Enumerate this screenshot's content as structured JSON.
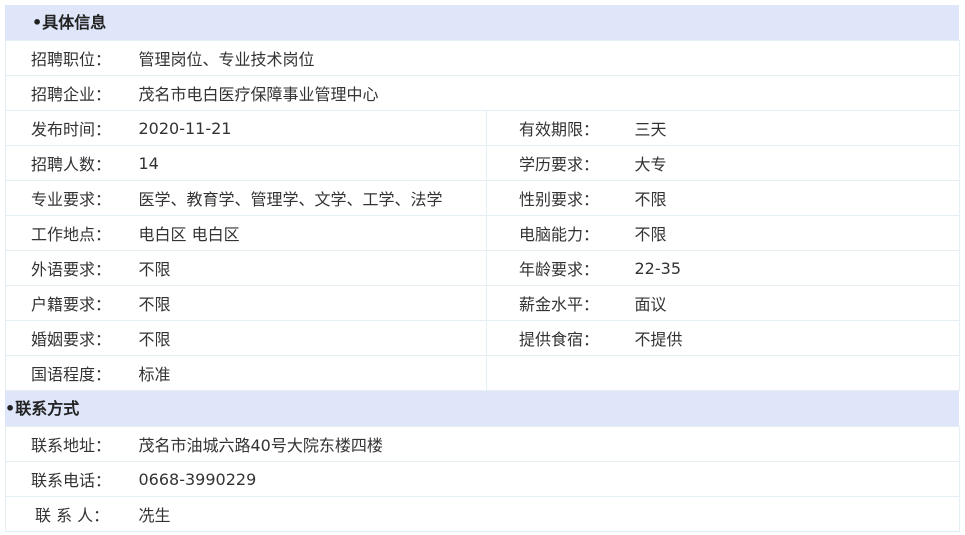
{
  "section1": {
    "title": "•具体信息",
    "rows_full": [
      {
        "label": "招聘职位：",
        "value": "管理岗位、专业技术岗位"
      },
      {
        "label": "招聘企业：",
        "value": "茂名市电白医疗保障事业管理中心"
      }
    ],
    "rows_pair": [
      {
        "label1": "发布时间：",
        "value1": "2020-11-21",
        "label2": "有效期限：",
        "value2": "三天"
      },
      {
        "label1": "招聘人数：",
        "value1": "14",
        "label2": "学历要求：",
        "value2": "大专"
      },
      {
        "label1": "专业要求：",
        "value1": "医学、教育学、管理学、文学、工学、法学",
        "label2": "性别要求：",
        "value2": "不限"
      },
      {
        "label1": "工作地点：",
        "value1": "电白区 电白区",
        "label2": "电脑能力：",
        "value2": "不限"
      },
      {
        "label1": "外语要求：",
        "value1": "不限",
        "label2": "年龄要求：",
        "value2": "22-35"
      },
      {
        "label1": "户籍要求：",
        "value1": "不限",
        "label2": "薪金水平：",
        "value2": "面议"
      },
      {
        "label1": "婚姻要求：",
        "value1": "不限",
        "label2": "提供食宿：",
        "value2": "不提供"
      },
      {
        "label1": "国语程度：",
        "value1": "标准",
        "label2": "",
        "value2": ""
      }
    ]
  },
  "section2": {
    "title": "•联系方式",
    "rows": [
      {
        "label": "联系地址：",
        "value": "茂名市油城六路40号大院东楼四楼"
      },
      {
        "label": "联系电话：",
        "value": "0668-3990229"
      },
      {
        "label": "联 系 人：",
        "value": "冼生"
      }
    ]
  }
}
